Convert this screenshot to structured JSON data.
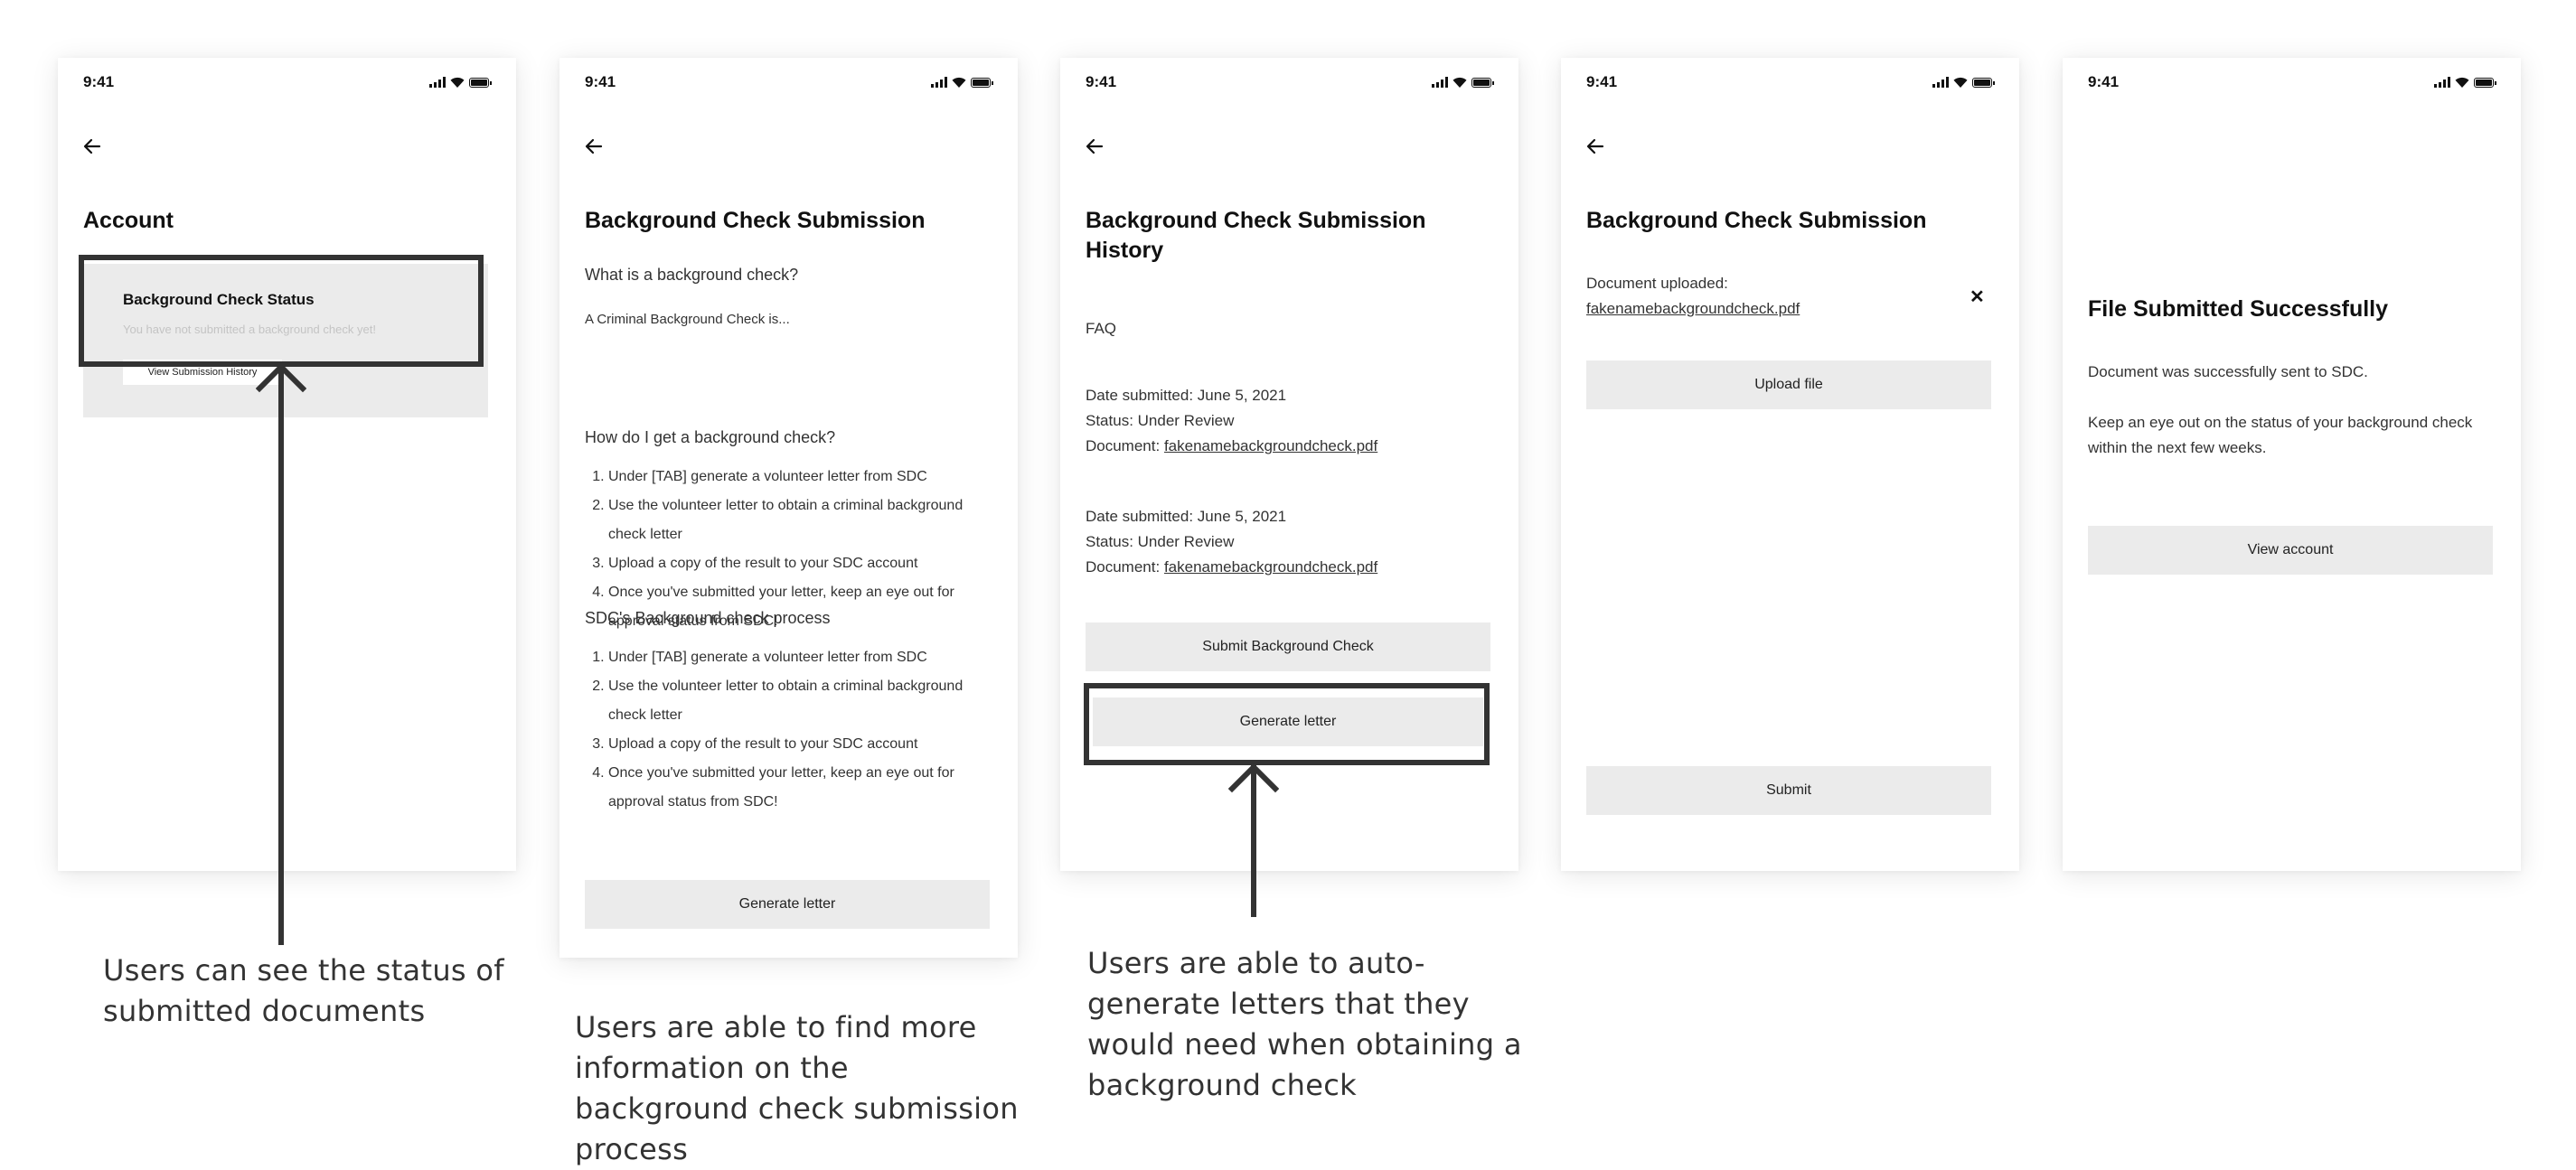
{
  "status_bar": {
    "time": "9:41"
  },
  "screens": {
    "account": {
      "title": "Account",
      "card_title": "Background Check Status",
      "card_status": "You have not submitted a background check yet!",
      "history_button": "View Submission History"
    },
    "submission_info": {
      "title": "Background Check Submission",
      "q1": "What is a background check?",
      "a1": "A Criminal Background Check is...",
      "q2": "How do I get a background check?",
      "steps": [
        "Under [TAB] generate a volunteer letter from SDC",
        "Use the volunteer letter to obtain a criminal background check letter",
        "Upload a copy of the result to your SDC account",
        "Once you've submitted your letter, keep an eye out for approval status from SDC!"
      ],
      "q3": "SDC's Background check process",
      "process_steps": [
        "Under [TAB] generate a volunteer letter from SDC",
        "Use the volunteer letter to obtain a criminal background check letter",
        "Upload a copy of the result to your SDC account",
        "Once you've submitted your letter, keep an eye out for approval status from SDC!"
      ],
      "button": "Generate letter"
    },
    "history": {
      "title": "Background Check Submission History",
      "faq": "FAQ",
      "entries": [
        {
          "date": "Date submitted: June 5, 2021",
          "status": "Status: Under Review",
          "doc_label": "Document: ",
          "doc_link": "fakenamebackgroundcheck.pdf"
        },
        {
          "date": "Date submitted: June 5, 2021",
          "status": "Status: Under Review",
          "doc_label": "Document: ",
          "doc_link": "fakenamebackgroundcheck.pdf"
        }
      ],
      "submit_button": "Submit Background Check",
      "generate_button": "Generate letter"
    },
    "upload": {
      "title": "Background Check Submission",
      "uploaded_label": "Document uploaded:",
      "file_name": "fakenamebackgroundcheck.pdf",
      "remove_glyph": "✕",
      "upload_button": "Upload file",
      "submit_button": "Submit"
    },
    "success": {
      "title": "File Submitted Successfully",
      "msg1": "Document was successfully sent to SDC.",
      "msg2": "Keep an eye out on the status of your background check within the next few weeks.",
      "button": "View account"
    }
  },
  "captions": {
    "status": "Users can see the status of submitted documents",
    "info": "Users are able to find more information on the background check submission process",
    "generate": "Users are able to auto-generate letters that they would need when obtaining a background check"
  },
  "icons": [
    "signal-icon",
    "wifi-icon",
    "battery-icon",
    "back-arrow-icon",
    "close-icon",
    "up-arrow-icon"
  ],
  "colors": {
    "button_bg": "#ebebeb",
    "highlight": "#333333",
    "card_bg": "#ebebeb"
  }
}
